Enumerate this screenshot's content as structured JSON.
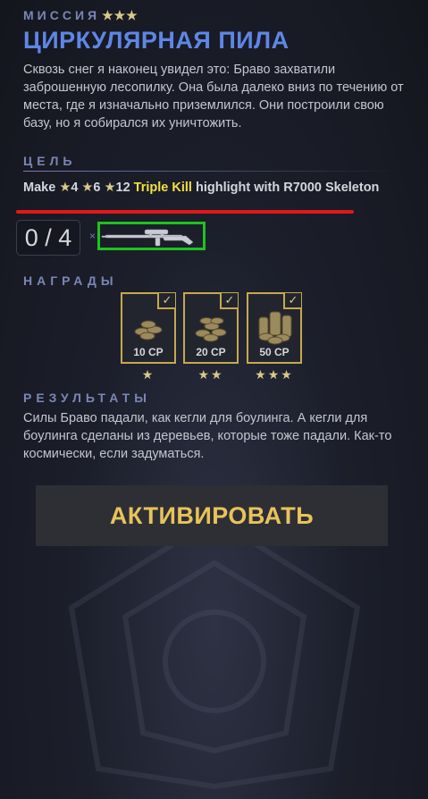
{
  "mission": {
    "label": "МИССИЯ",
    "stars": "★★★",
    "title": "ЦИРКУЛЯРНАЯ ПИЛА",
    "description": "Сквозь снег я наконец увидел это: Браво захватили заброшенную лесопилку. Она была далеко вниз по течению от места, где я изначально приземлился. Они построили свою базу, но я собирался их уничтожить."
  },
  "goal": {
    "label": "ЦЕЛЬ",
    "text_make": "Make ",
    "star1": "★",
    "val1": "4 ",
    "star2": "★",
    "val2": "6 ",
    "star3": "★",
    "val3": "12 ",
    "highlight": "Triple Kill",
    "text_rest": " highlight with R7000 Skeleton",
    "progress": "0 / 4",
    "times_symbol": "×",
    "weapon_icon": "sniper-rifle-icon"
  },
  "rewards": {
    "label": "НАГРАДЫ",
    "items": [
      {
        "amount": "10 CP",
        "stars": "★",
        "check": "✓"
      },
      {
        "amount": "20 CP",
        "stars": "★★",
        "check": "✓"
      },
      {
        "amount": "50 CP",
        "stars": "★★★",
        "check": "✓"
      }
    ]
  },
  "results": {
    "label": "РЕЗУЛЬТАТЫ",
    "text": "Силы Браво падали, как кегли для боулинга. А кегли для боулинга сделаны из деревьев, которые тоже падали. Как-то космически, если задуматься."
  },
  "activate_button": "АКТИВИРОВАТЬ",
  "colors": {
    "accent_blue": "#5f86e6",
    "gold": "#c5a94e",
    "highlight_yellow": "#f0e040",
    "annotation_red": "#e01818",
    "annotation_green": "#1ec31e"
  }
}
